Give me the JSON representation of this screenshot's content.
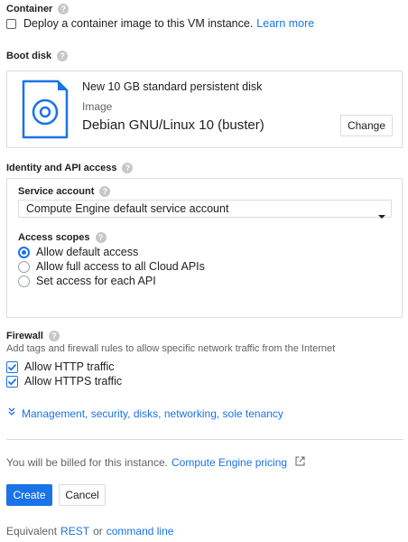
{
  "container": {
    "title": "Container",
    "deploy_text": "Deploy a container image to this VM instance.",
    "learn_more": "Learn more"
  },
  "boot_disk": {
    "title": "Boot disk",
    "disk_name": "New 10 GB standard persistent disk",
    "image_label": "Image",
    "image_value": "Debian GNU/Linux 10 (buster)",
    "change_label": "Change"
  },
  "identity": {
    "title": "Identity and API access",
    "service_account_label": "Service account",
    "service_account_value": "Compute Engine default service account",
    "access_scopes_label": "Access scopes",
    "scopes": [
      {
        "label": "Allow default access",
        "selected": true
      },
      {
        "label": "Allow full access to all Cloud APIs",
        "selected": false
      },
      {
        "label": "Set access for each API",
        "selected": false
      }
    ]
  },
  "firewall": {
    "title": "Firewall",
    "description": "Add tags and firewall rules to allow specific network traffic from the Internet",
    "options": [
      {
        "label": "Allow HTTP traffic",
        "checked": true
      },
      {
        "label": "Allow HTTPS traffic",
        "checked": true
      }
    ]
  },
  "management_link": "Management, security, disks, networking, sole tenancy",
  "billing": {
    "text": "You will be billed for this instance.",
    "pricing_link": "Compute Engine pricing"
  },
  "actions": {
    "create": "Create",
    "cancel": "Cancel"
  },
  "equivalent": {
    "prefix": "Equivalent",
    "rest": "REST",
    "or": "or",
    "command_line": "command line"
  },
  "colors": {
    "accent": "#1a73e8",
    "border": "#dadce0",
    "text": "#202124",
    "muted": "#5f6368"
  }
}
